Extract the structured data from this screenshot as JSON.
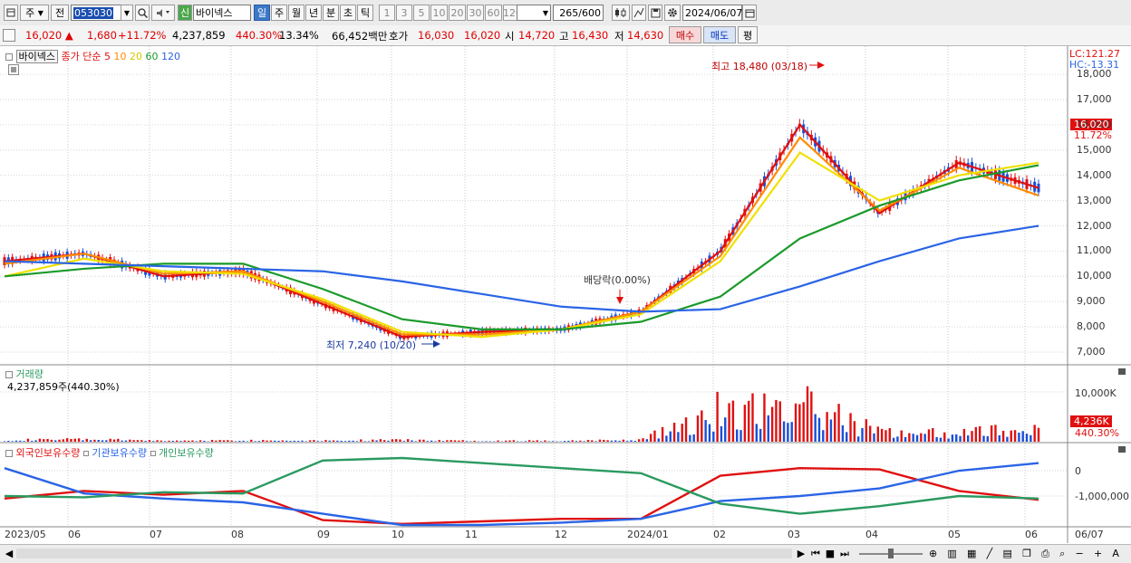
{
  "toolbar": {
    "market": "주",
    "prev": "전",
    "code": "053030",
    "credit": "신",
    "stock_name": "바이넥스",
    "periods": [
      "일",
      "주",
      "월",
      "년",
      "분",
      "초",
      "틱"
    ],
    "intervals": [
      "1",
      "3",
      "5",
      "10",
      "20",
      "30",
      "60",
      "120"
    ],
    "count": "265",
    "count_total": "/600",
    "date": "2024/06/07"
  },
  "quote": {
    "price": "16,020",
    "change": "1,680",
    "change_pct": "+11.72%",
    "volume": "4,237,859",
    "volume_ratio": "440.30%",
    "turnover": "13.34%",
    "amount": "66,452백만",
    "bid_label": "호가",
    "bid1": "16,030",
    "bid2": "16,020",
    "open_label": "시",
    "open": "14,720",
    "high_label": "고",
    "high": "16,430",
    "low_label": "저",
    "low": "14,630",
    "buy": "매수",
    "sell": "매도",
    "eval": "평"
  },
  "price_panel": {
    "name": "바이넥스",
    "legend_prefix": "종가 단순",
    "ma": [
      {
        "label": "5",
        "color": "#e01010"
      },
      {
        "label": "10",
        "color": "#ff8c00"
      },
      {
        "label": "20",
        "color": "#f0e000"
      },
      {
        "label": "60",
        "color": "#1a9a2a"
      },
      {
        "label": "120",
        "color": "#2a64e6"
      }
    ],
    "lc": "LC:121.27",
    "hc": "HC:-13.31",
    "high_note": "최고 18,480 (03/18)",
    "low_note": "최저 7,240 (10/20)",
    "dividend_note": "배당락(0.00%)",
    "y_ticks": [
      "18,000",
      "17,000",
      "16,000",
      "15,000",
      "14,000",
      "13,000",
      "12,000",
      "11,000",
      "10,000",
      "9,000",
      "8,000",
      "7,000"
    ],
    "current_price": "16,020",
    "current_pct": "11.72%"
  },
  "volume_panel": {
    "title": "거래량",
    "value": "4,237,859주(440.30%)",
    "tick": "10,000K",
    "current": "4,236K",
    "current_pct": "440.30%"
  },
  "holdings_panel": {
    "series": [
      {
        "label": "외국인보유수량",
        "color": "#e01010"
      },
      {
        "label": "기관보유수량",
        "color": "#2a64e6"
      },
      {
        "label": "개인보유수량",
        "color": "#2a9a60"
      }
    ],
    "ticks": [
      "0",
      "-1,000,000"
    ]
  },
  "x_axis": [
    "2023/05",
    "06",
    "07",
    "08",
    "09",
    "10",
    "11",
    "12",
    "2024/01",
    "02",
    "03",
    "04",
    "05",
    "06",
    "06/07"
  ],
  "chart_data": [
    {
      "type": "line",
      "title": "바이넥스",
      "ylabel": "",
      "ylim": [
        6500,
        18500
      ],
      "x": [
        "2023/05",
        "06",
        "07",
        "08",
        "09",
        "10",
        "11",
        "12",
        "2024/01",
        "02",
        "03",
        "04",
        "05",
        "06"
      ],
      "series": [
        {
          "name": "5",
          "values": [
            10600,
            10900,
            10000,
            10200,
            8900,
            7600,
            7800,
            7900,
            8600,
            11000,
            16000,
            12500,
            14500,
            13500
          ]
        },
        {
          "name": "10",
          "values": [
            10500,
            10900,
            10100,
            10200,
            9000,
            7700,
            7700,
            7900,
            8600,
            10800,
            15500,
            12600,
            14300,
            13200
          ]
        },
        {
          "name": "20",
          "values": [
            10000,
            10700,
            10200,
            10100,
            9100,
            7800,
            7600,
            7900,
            8500,
            10600,
            14900,
            13000,
            14000,
            14500
          ]
        },
        {
          "name": "60",
          "values": [
            10000,
            10300,
            10500,
            10500,
            9500,
            8300,
            7900,
            7900,
            8200,
            9200,
            11500,
            12800,
            13800,
            14400
          ]
        },
        {
          "name": "120",
          "values": [
            10600,
            10500,
            10400,
            10300,
            10200,
            9800,
            9300,
            8800,
            8600,
            8700,
            9600,
            10600,
            11500,
            12000
          ]
        }
      ]
    },
    {
      "type": "bar",
      "title": "거래량",
      "x": [
        "2023/05",
        "06",
        "07",
        "08",
        "09",
        "10",
        "11",
        "12",
        "2024/01",
        "02",
        "03",
        "04",
        "05",
        "06"
      ],
      "series": [
        {
          "name": "거래량",
          "values": [
            500,
            700,
            300,
            400,
            400,
            500,
            300,
            300,
            600,
            9500,
            11000,
            3000,
            2500,
            4236
          ]
        }
      ]
    },
    {
      "type": "line",
      "x": [
        "2023/05",
        "06",
        "07",
        "08",
        "09",
        "10",
        "11",
        "12",
        "2024/01",
        "02",
        "03",
        "04",
        "05",
        "06"
      ],
      "series": [
        {
          "name": "외국인보유수량",
          "values": [
            -1100000,
            -800000,
            -950000,
            -800000,
            -1950000,
            -2100000,
            -2000000,
            -1900000,
            -1900000,
            -200000,
            100000,
            50000,
            -800000,
            -1150000
          ]
        },
        {
          "name": "기관보유수량",
          "values": [
            100000,
            -900000,
            -1100000,
            -1250000,
            -1700000,
            -2150000,
            -2150000,
            -2050000,
            -1900000,
            -1200000,
            -1000000,
            -700000,
            0,
            300000
          ]
        },
        {
          "name": "개인보유수량",
          "values": [
            -1000000,
            -1050000,
            -850000,
            -900000,
            400000,
            500000,
            300000,
            100000,
            -100000,
            -1300000,
            -1700000,
            -1400000,
            -1000000,
            -1100000
          ]
        }
      ]
    }
  ]
}
